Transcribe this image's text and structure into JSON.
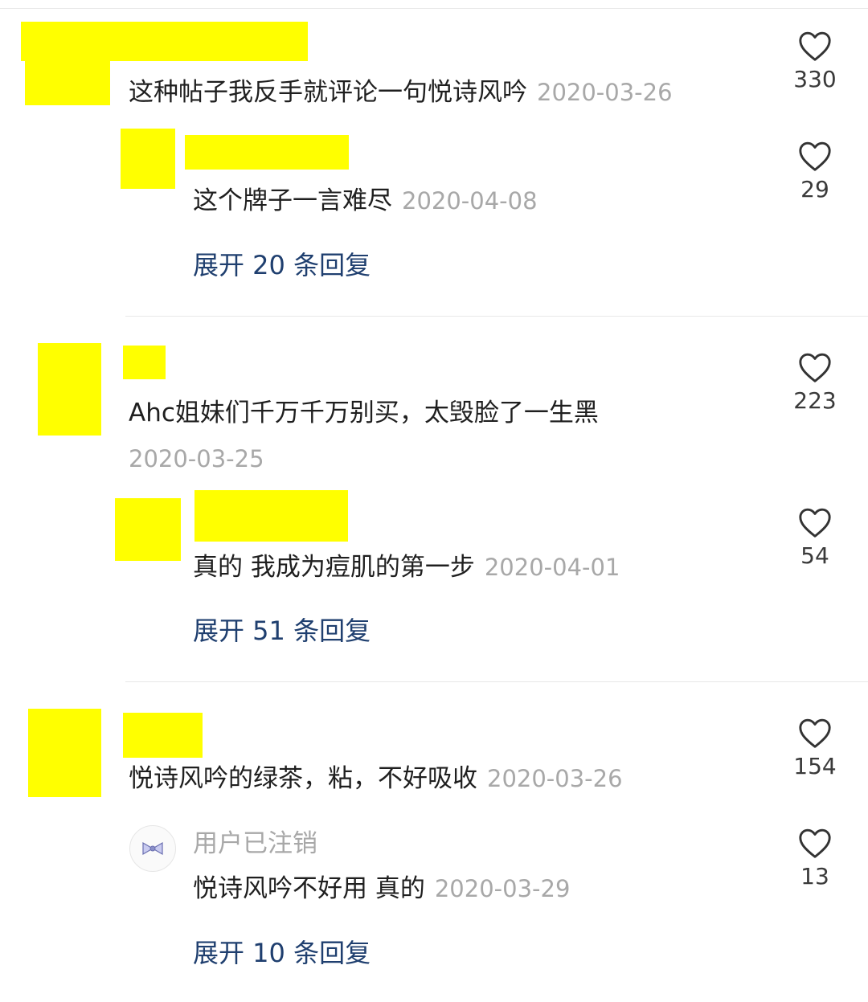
{
  "comments": [
    {
      "text": "这种帖子我反手就评论一句悦诗风吟",
      "date": "2020-03-26",
      "likes": "330",
      "reply": {
        "text": "这个牌子一言难尽",
        "date": "2020-04-08",
        "likes": "29"
      },
      "expand_label": "展开 20 条回复"
    },
    {
      "text": "Ahc姐妹们千万千万别买，太毁脸了一生黑",
      "date": "2020-03-25",
      "likes": "223",
      "reply": {
        "text": "真的 我成为痘肌的第一步",
        "date": "2020-04-01",
        "likes": "54"
      },
      "expand_label": "展开 51 条回复"
    },
    {
      "text": "悦诗风吟的绿茶，粘，不好吸收",
      "date": "2020-03-26",
      "likes": "154",
      "reply": {
        "username": "用户已注销",
        "text": "悦诗风吟不好用 真的",
        "date": "2020-03-29",
        "likes": "13"
      },
      "expand_label": "展开 10 条回复"
    }
  ],
  "colors": {
    "redaction": "#ffff00",
    "link": "#1f3f6f",
    "date": "#a8a8a8"
  },
  "icons": {
    "like": "heart-outline-icon",
    "avatar_placeholder": "bow-icon"
  }
}
